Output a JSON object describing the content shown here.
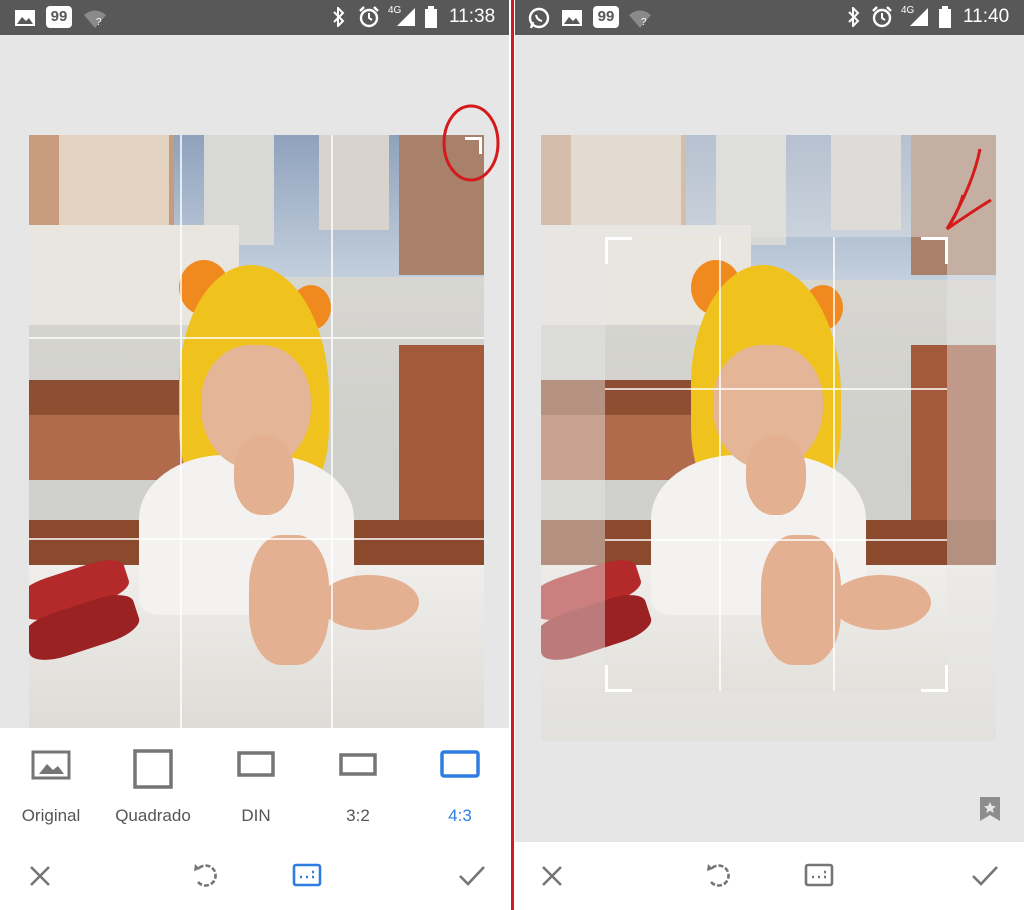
{
  "left": {
    "status": {
      "time": "11:38",
      "network": "4G",
      "notification_badge": "99"
    },
    "aspect_ratios": [
      {
        "label": "Original",
        "selected": false
      },
      {
        "label": "Quadrado",
        "selected": false
      },
      {
        "label": "DIN",
        "selected": false
      },
      {
        "label": "3:2",
        "selected": false
      },
      {
        "label": "4:3",
        "selected": true
      }
    ],
    "actions": [
      "close-icon",
      "rotate-icon",
      "aspect-ratio-icon",
      "check-icon"
    ]
  },
  "right": {
    "status": {
      "time": "11:40",
      "network": "4G",
      "notification_badge": "99"
    },
    "actions": [
      "close-icon",
      "rotate-icon",
      "aspect-ratio-icon",
      "check-icon"
    ]
  },
  "colors": {
    "selected_accent": "#2f7de1",
    "annotation_red": "#d41a1a",
    "status_bar": "#585858",
    "canvas_bg": "#e6e6e6"
  }
}
